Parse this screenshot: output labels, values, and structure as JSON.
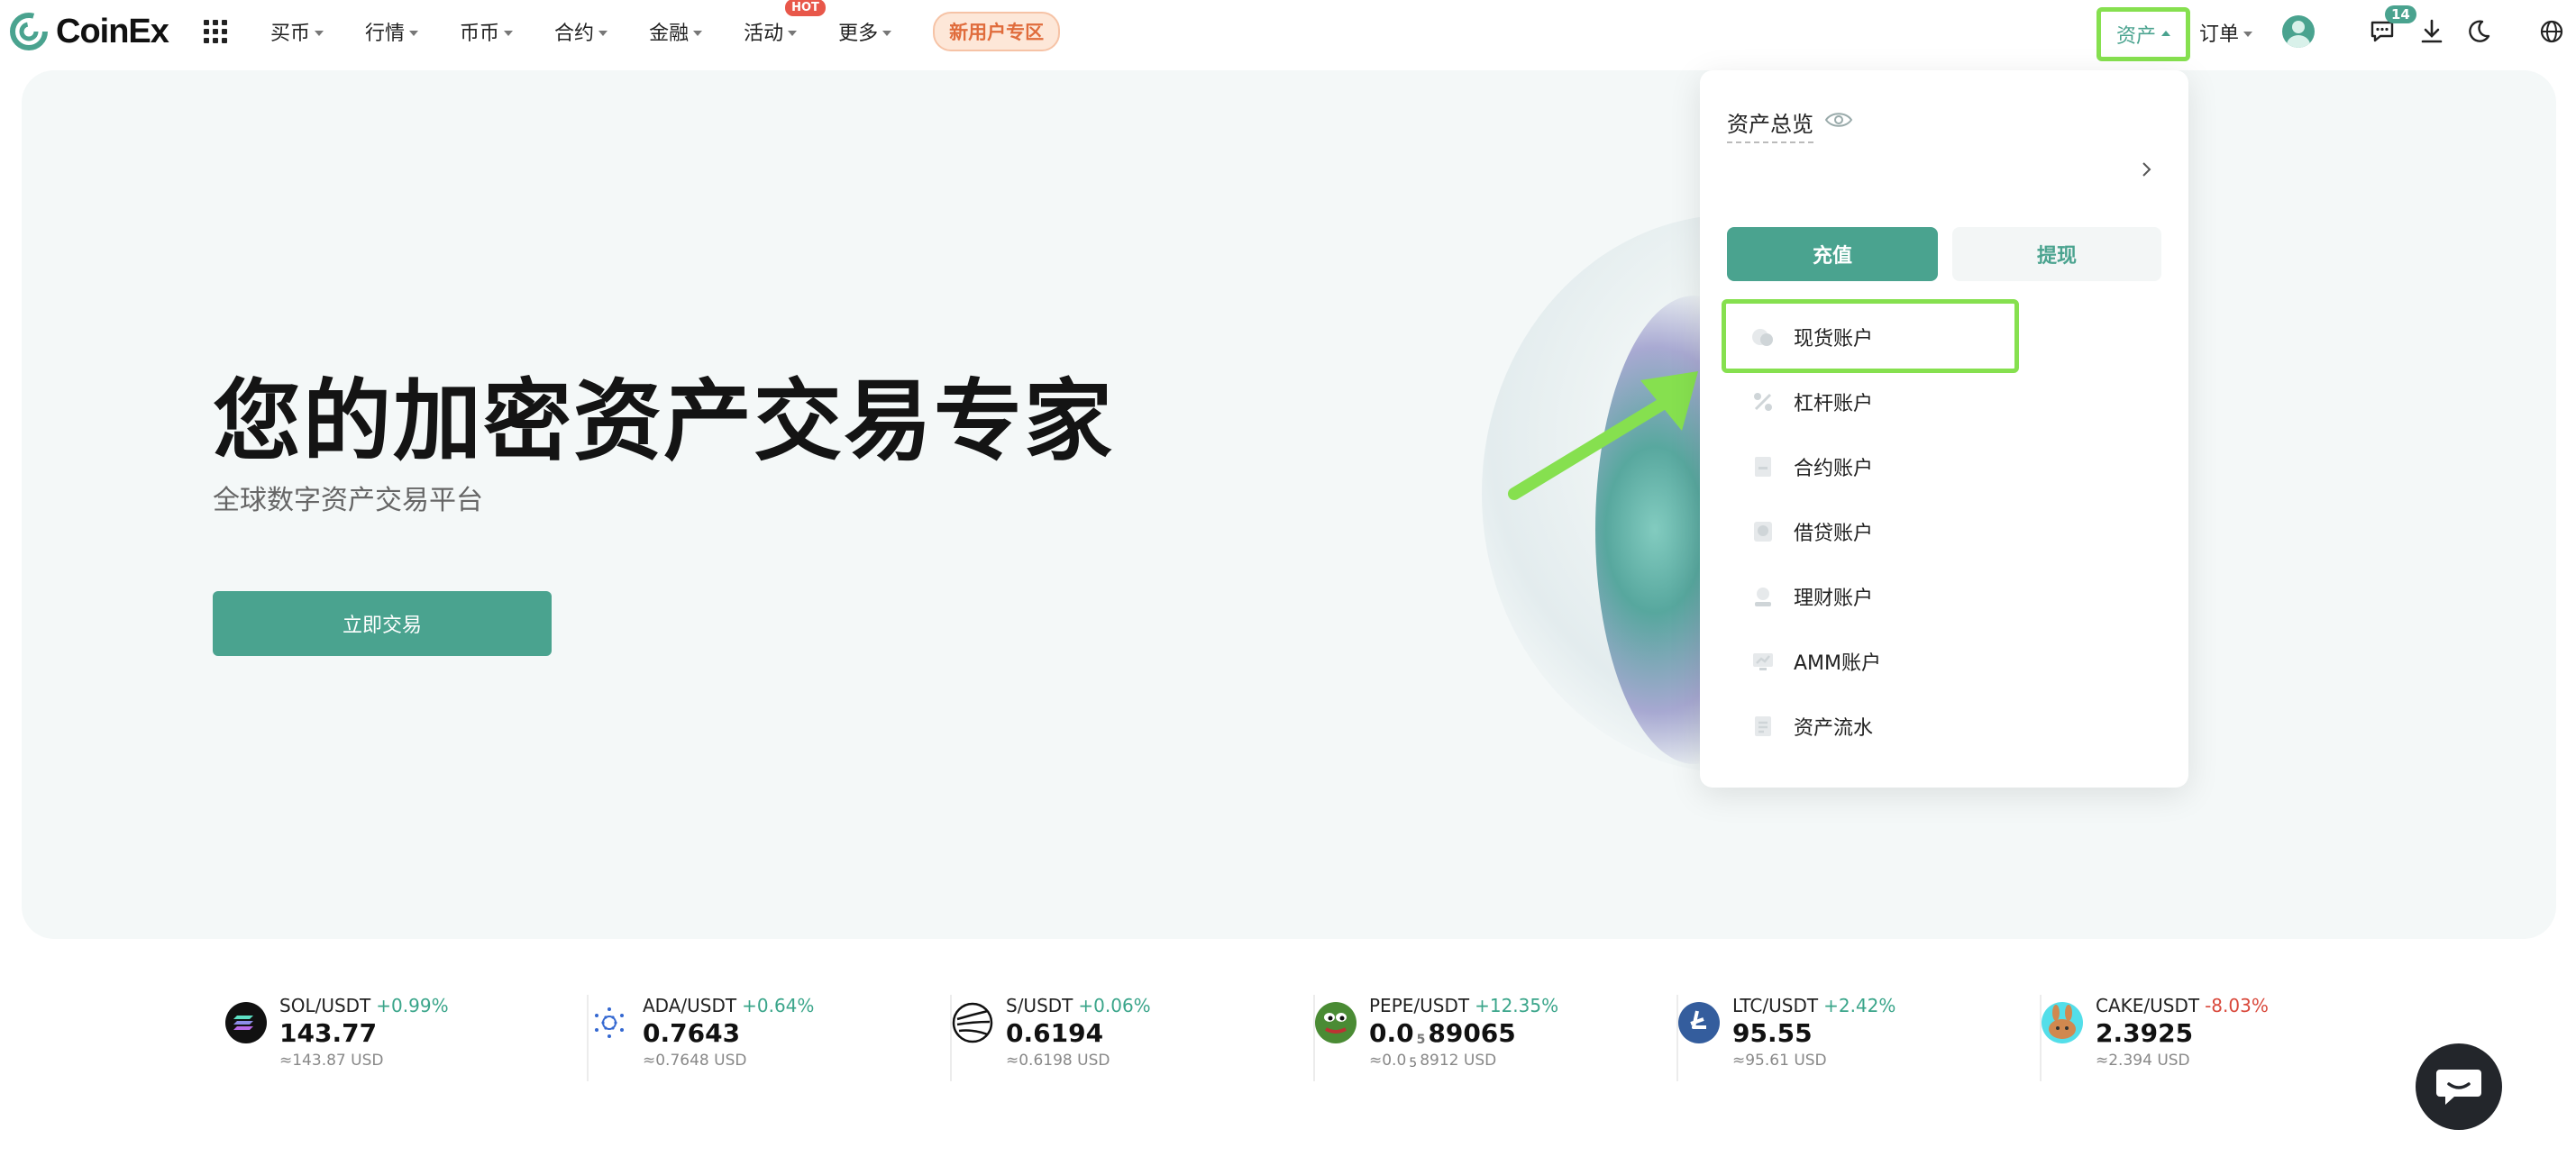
{
  "nav": {
    "logo_text": "CoinEx",
    "menu": [
      {
        "label": "买币",
        "caret": true
      },
      {
        "label": "行情",
        "caret": true
      },
      {
        "label": "币币",
        "caret": true
      },
      {
        "label": "合约",
        "caret": true
      },
      {
        "label": "金融",
        "caret": true
      },
      {
        "label": "活动",
        "caret": true,
        "badge": "HOT"
      },
      {
        "label": "更多",
        "caret": true
      }
    ],
    "new_user_label": "新用户专区",
    "assets_label": "资产",
    "orders_label": "订单",
    "message_count": "14",
    "icons": [
      "apps-grid-icon",
      "avatar",
      "message-icon",
      "download-icon",
      "moon-icon",
      "globe-icon"
    ]
  },
  "hero": {
    "title": "您的加密资产交易专家",
    "subtitle": "全球数字资产交易平台",
    "cta_label": "立即交易"
  },
  "assets_dropdown": {
    "title": "资产总览",
    "deposit_label": "充值",
    "withdraw_label": "提现",
    "items": [
      {
        "label": "现货账户",
        "icon": "spot-account-icon",
        "highlighted": true
      },
      {
        "label": "杠杆账户",
        "icon": "margin-account-icon"
      },
      {
        "label": "合约账户",
        "icon": "futures-account-icon"
      },
      {
        "label": "借贷账户",
        "icon": "loan-account-icon"
      },
      {
        "label": "理财账户",
        "icon": "financial-account-icon"
      },
      {
        "label": "AMM账户",
        "icon": "amm-account-icon"
      },
      {
        "label": "资产流水",
        "icon": "asset-history-icon"
      }
    ]
  },
  "tickers": [
    {
      "pair": "SOL/USDT",
      "change": "+0.99%",
      "price": "143.77",
      "usd": "≈143.87 USD",
      "icon": "sol-icon"
    },
    {
      "pair": "ADA/USDT",
      "change": "+0.64%",
      "price": "0.7643",
      "usd": "≈0.7648 USD",
      "icon": "ada-icon"
    },
    {
      "pair": "S/USDT",
      "change": "+0.06%",
      "price": "0.6194",
      "usd": "≈0.6198 USD",
      "icon": "s-icon"
    },
    {
      "pair": "PEPE/USDT",
      "change": "+12.35%",
      "price_prefix": "0.0",
      "price_sub": "5",
      "price_suffix": "89065",
      "usd_prefix": "≈0.0",
      "usd_sub": "5",
      "usd_suffix": "8912 USD",
      "icon": "pepe-icon"
    },
    {
      "pair": "LTC/USDT",
      "change": "+2.42%",
      "price": "95.55",
      "usd": "≈95.61 USD",
      "icon": "ltc-icon"
    },
    {
      "pair": "CAKE/USDT",
      "change": "-8.03%",
      "price": "2.3925",
      "usd": "≈2.394 USD",
      "icon": "cake-icon"
    }
  ],
  "colors": {
    "brand": "#4aa38f",
    "up": "#3aa58a",
    "down": "#d9483b",
    "highlight": "#86e04f"
  }
}
